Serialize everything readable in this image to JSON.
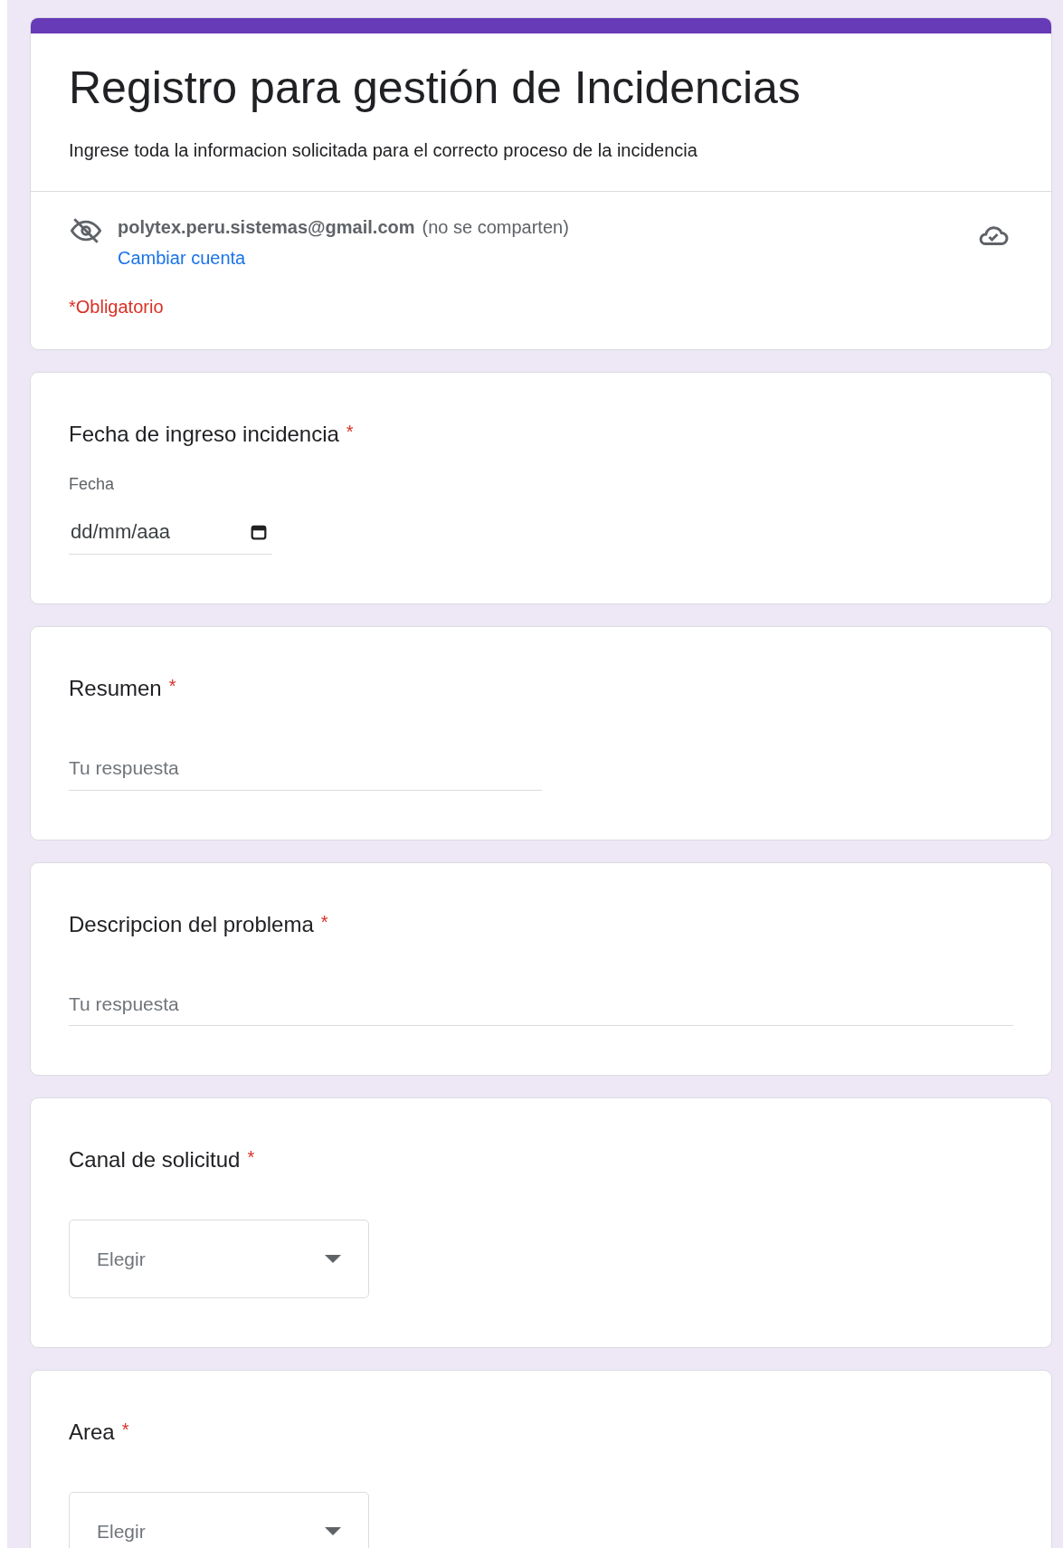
{
  "form": {
    "title": "Registro para gestión de Incidencias",
    "description": "Ingrese toda la informacion solicitada para el correcto proceso de la incidencia",
    "account_email": "polytex.peru.sistemas@gmail.com",
    "account_note": "(no se comparten)",
    "switch_account_link": "Cambiar cuenta",
    "required_note": "*Obligatorio"
  },
  "questions": [
    {
      "kind": "date",
      "title": "Fecha de ingreso incidencia",
      "required": true,
      "required_mark": "*",
      "sublabel": "Fecha",
      "value": "dd/mm/aaa"
    },
    {
      "kind": "short",
      "title": "Resumen",
      "required": true,
      "required_mark": "*",
      "placeholder": "Tu respuesta"
    },
    {
      "kind": "paragraph",
      "title": "Descripcion del problema",
      "required": true,
      "required_mark": "*",
      "placeholder": "Tu respuesta"
    },
    {
      "kind": "dropdown",
      "title": "Canal de solicitud",
      "required": true,
      "required_mark": "*",
      "placeholder": "Elegir"
    },
    {
      "kind": "dropdown",
      "title": "Area",
      "required": true,
      "required_mark": "*",
      "placeholder": "Elegir"
    }
  ]
}
